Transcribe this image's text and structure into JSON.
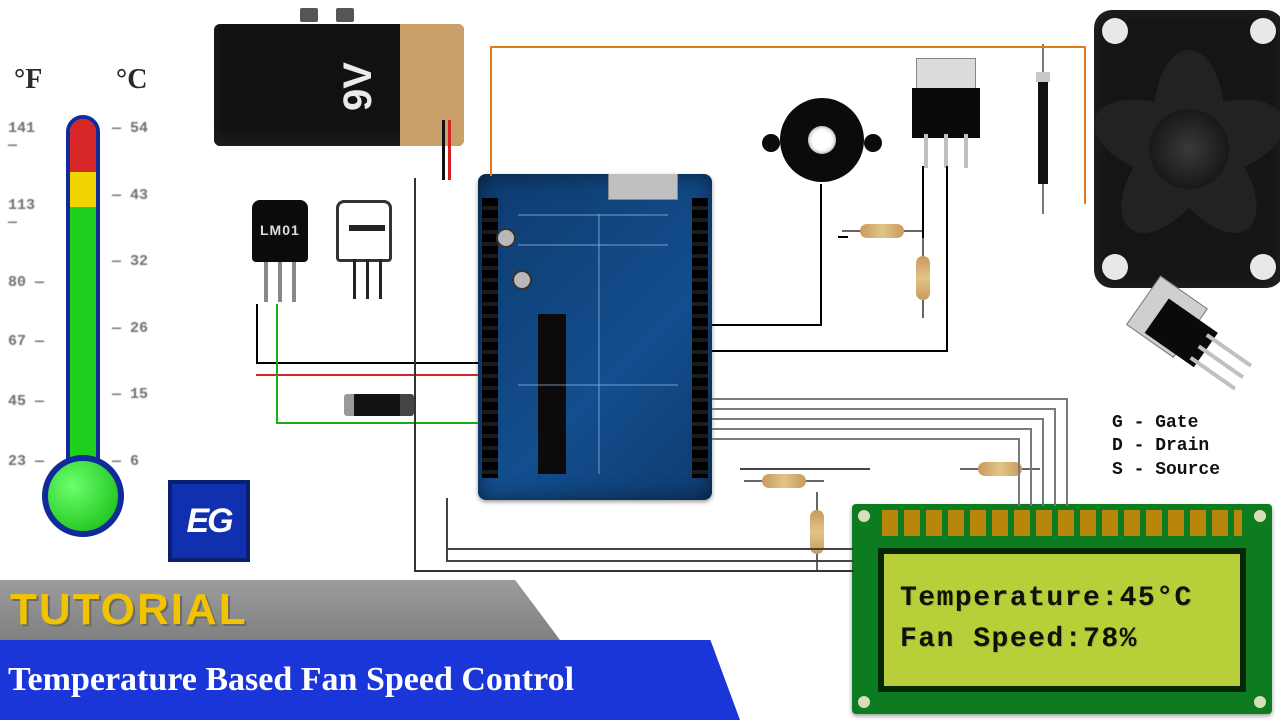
{
  "thermometer": {
    "unit_f": "°F",
    "unit_c": "°C",
    "ticks_f": [
      "141 —",
      "113 —",
      "80 —",
      "67 —",
      "45 —",
      "23 —"
    ],
    "ticks_c": [
      "— 54",
      "— 43",
      "— 32",
      "— 26",
      "— 15",
      "— 6"
    ]
  },
  "logo": {
    "text": "EG"
  },
  "banner": {
    "tutorial": "TUTORIAL",
    "title": "Temperature Based Fan Speed Control"
  },
  "battery": {
    "label": "9V"
  },
  "lm35": {
    "label": "LM01"
  },
  "pin_legend": {
    "l1": "G - Gate",
    "l2": "D - Drain",
    "l3": "S - Source"
  },
  "lcd": {
    "line1": "Temperature:45°C",
    "line2": "Fan Speed:78%"
  }
}
